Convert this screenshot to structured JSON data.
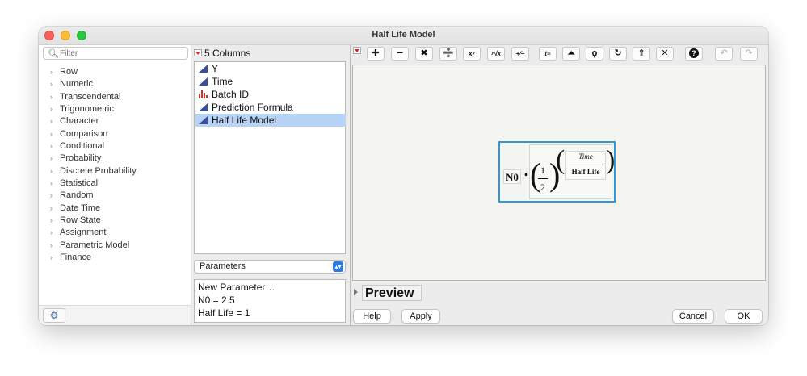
{
  "window": {
    "title": "Half Life Model"
  },
  "filter": {
    "placeholder": "Filter"
  },
  "categories": [
    "Row",
    "Numeric",
    "Transcendental",
    "Trigonometric",
    "Character",
    "Comparison",
    "Conditional",
    "Probability",
    "Discrete Probability",
    "Statistical",
    "Random",
    "Date Time",
    "Row State",
    "Assignment",
    "Parametric Model",
    "Finance"
  ],
  "columns": {
    "header": "5 Columns",
    "items": [
      {
        "label": "Y",
        "type": "continuous-icon"
      },
      {
        "label": "Time",
        "type": "continuous-icon"
      },
      {
        "label": "Batch ID",
        "type": "nominal-icon"
      },
      {
        "label": "Prediction Formula",
        "type": "continuous-icon"
      },
      {
        "label": "Half Life Model",
        "type": "continuous-icon",
        "selected": true
      }
    ]
  },
  "parameters": {
    "select_value": "Parameters",
    "items": [
      "New Parameter…",
      "N0 = 2.5",
      "Half Life = 1"
    ]
  },
  "toolbar": {
    "buttons": [
      {
        "name": "add-button",
        "glyph": "✚"
      },
      {
        "name": "subtract-button",
        "glyph": "━"
      },
      {
        "name": "multiply-button",
        "glyph": "✖"
      },
      {
        "name": "divide-button",
        "glyph": "➗"
      },
      {
        "name": "power-button",
        "glyph": "xʸ"
      },
      {
        "name": "root-button",
        "glyph": "ʸ√x"
      },
      {
        "name": "negate-button",
        "glyph": "+⁄−"
      },
      {
        "name": "assign-button",
        "glyph": "t="
      },
      {
        "name": "peel-button",
        "glyph": "⏶"
      },
      {
        "name": "lasso-button",
        "glyph": "ϙ"
      },
      {
        "name": "refresh-button",
        "glyph": "↻"
      },
      {
        "name": "unthrow-button",
        "glyph": "⇑"
      },
      {
        "name": "delete-button",
        "glyph": "✕"
      },
      {
        "name": "help-button",
        "glyph": "?"
      },
      {
        "name": "undo-button",
        "glyph": "↶"
      },
      {
        "name": "redo-button",
        "glyph": "↷"
      }
    ]
  },
  "formula": {
    "coefficient": "N0",
    "operator": "•",
    "base_numerator": "1",
    "base_denominator": "2",
    "exp_numerator": "Time",
    "exp_denominator": "Half Life"
  },
  "preview": {
    "label": "Preview"
  },
  "buttons": {
    "help": "Help",
    "apply": "Apply",
    "cancel": "Cancel",
    "ok": "OK"
  },
  "colors": {
    "selection": "#b7d3f5",
    "formula_border": "#2a9ad8",
    "column_icon": "#3c4f9e"
  }
}
